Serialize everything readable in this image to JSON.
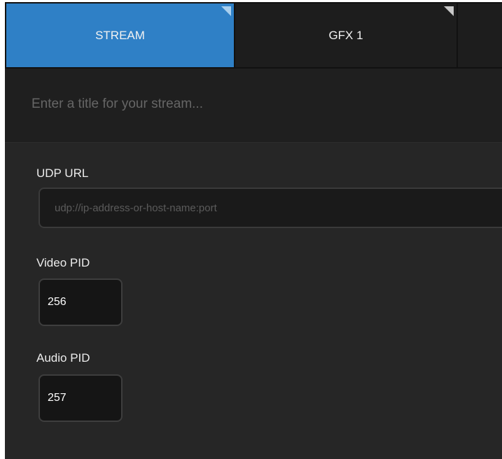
{
  "tabs": [
    {
      "label": "STREAM",
      "active": true
    },
    {
      "label": "GFX 1",
      "active": false
    },
    {
      "label": "",
      "active": false
    }
  ],
  "stream": {
    "title_placeholder": "Enter a title for your stream...",
    "title_value": ""
  },
  "form": {
    "udp_url": {
      "label": "UDP URL",
      "placeholder": "udp://ip-address-or-host-name:port",
      "value": ""
    },
    "video_pid": {
      "label": "Video PID",
      "value": "256"
    },
    "audio_pid": {
      "label": "Audio PID",
      "value": "257"
    }
  },
  "colors": {
    "active_tab": "#2f80c6",
    "inactive_tab": "#1d1d1d",
    "panel_background": "#262626",
    "title_bar_background": "#1f1f1f",
    "input_background": "#151515"
  }
}
